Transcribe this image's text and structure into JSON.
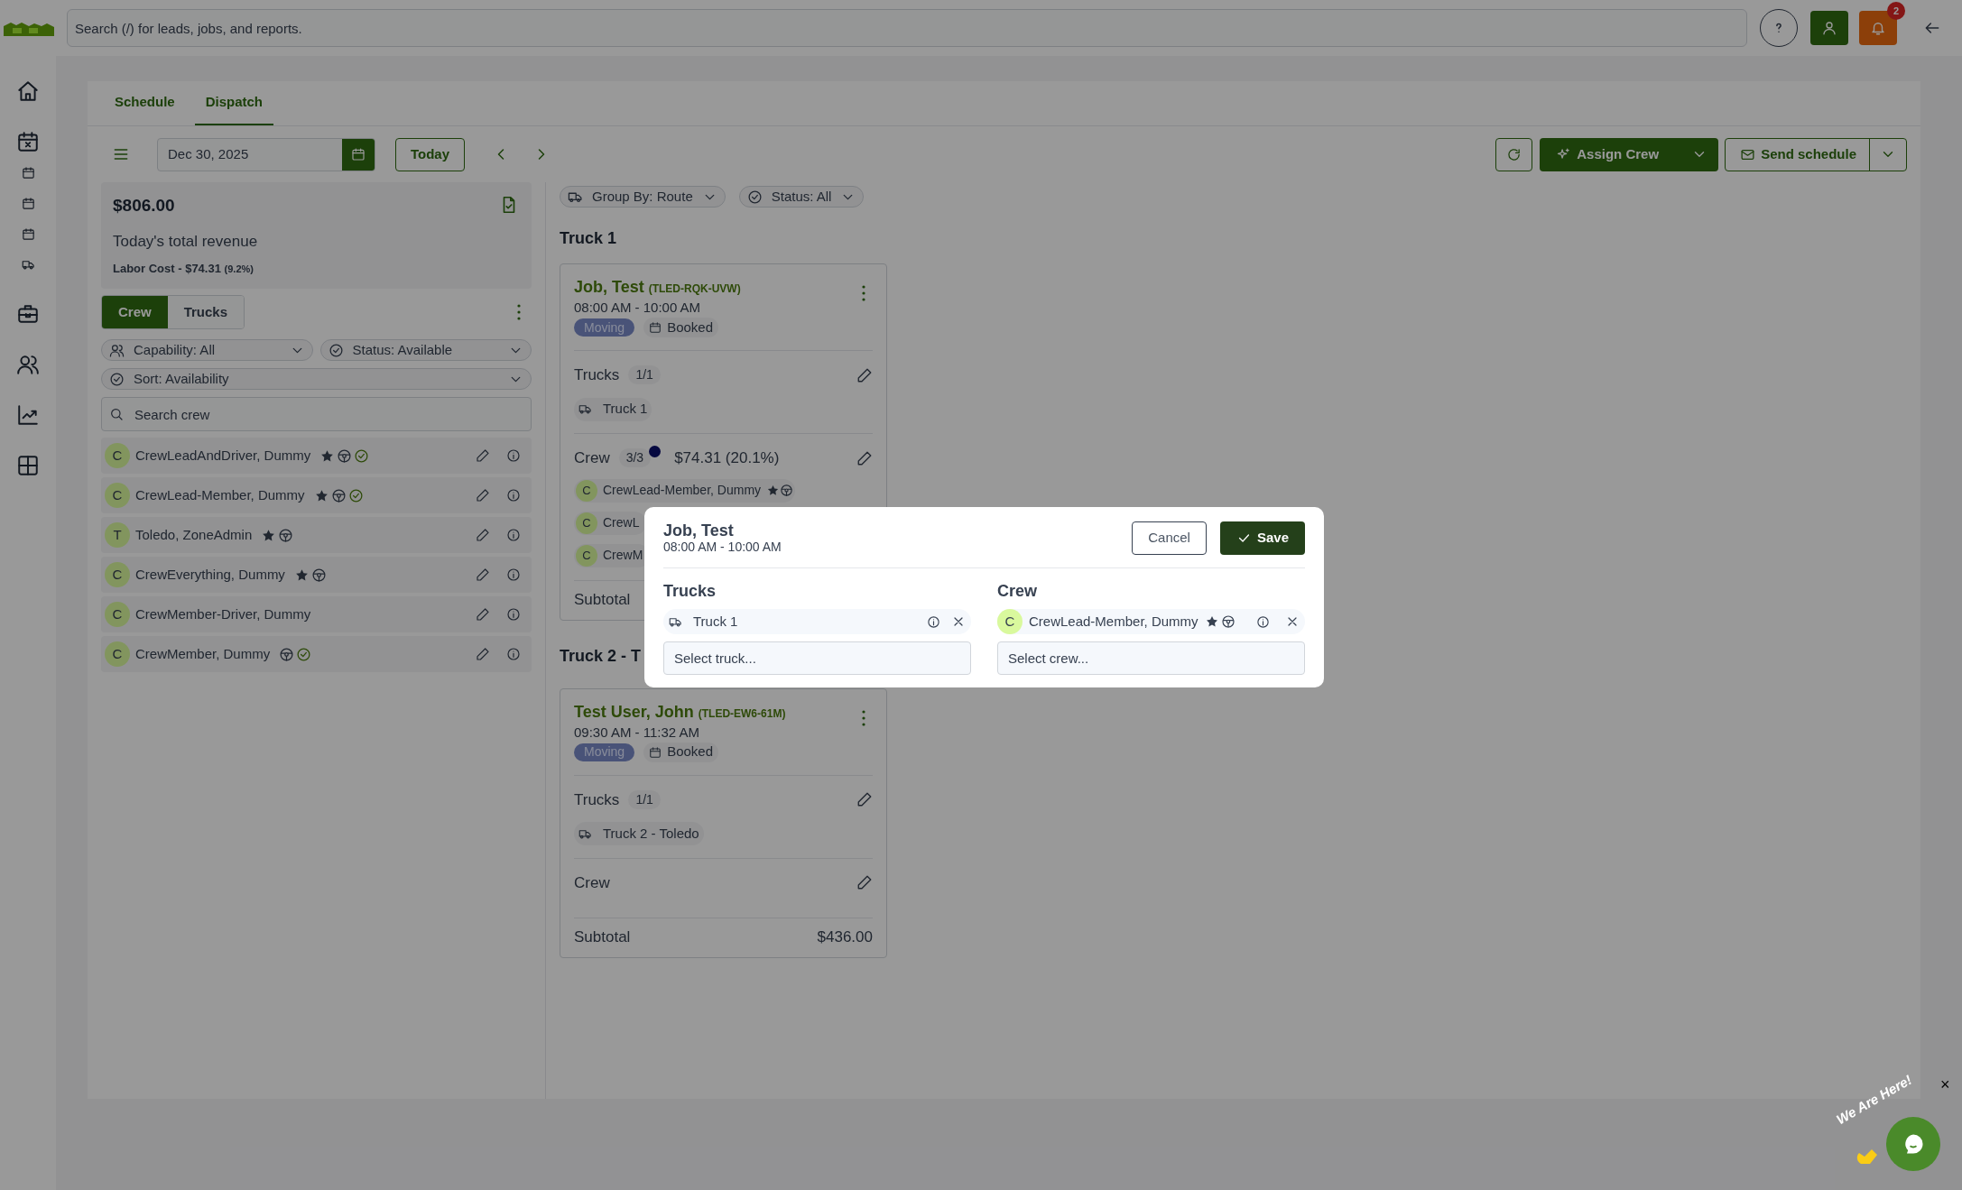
{
  "topbar": {
    "search_placeholder": "Search (/) for leads, jobs, and reports.",
    "notification_count": "2"
  },
  "tabs": [
    {
      "label": "Schedule",
      "selected": false
    },
    {
      "label": "Dispatch",
      "selected": true
    }
  ],
  "toolbar": {
    "date": "Dec 30, 2025",
    "today": "Today",
    "assign_crew": "Assign Crew",
    "send_schedule": "Send schedule"
  },
  "summary": {
    "revenue": "$806.00",
    "label": "Today's total revenue",
    "labor_cost": "Labor Cost - $74.31",
    "labor_share": "(9.2%)"
  },
  "panel_tabs": [
    {
      "label": "Crew",
      "selected": true
    },
    {
      "label": "Trucks",
      "selected": false
    }
  ],
  "filters": [
    {
      "kind": "people",
      "label": "Capability: All"
    },
    {
      "kind": "check",
      "label": "Status: Available"
    },
    {
      "kind": "check",
      "label": "Sort: Availability"
    }
  ],
  "crew_search": {
    "placeholder": "Search crew"
  },
  "crew": [
    {
      "initial": "C",
      "name": "CrewLeadAndDriver, Dummy",
      "lead": true,
      "driver": true,
      "verified": true
    },
    {
      "initial": "C",
      "name": "CrewLead-Member, Dummy",
      "lead": true,
      "driver": true,
      "verified": true
    },
    {
      "initial": "T",
      "name": "Toledo, ZoneAdmin",
      "lead": true,
      "driver": true,
      "verified": false
    },
    {
      "initial": "C",
      "name": "CrewEverything, Dummy",
      "lead": true,
      "driver": true,
      "verified": false
    },
    {
      "initial": "C",
      "name": "CrewMember-Driver, Dummy",
      "lead": false,
      "driver": false,
      "verified": false
    },
    {
      "initial": "C",
      "name": "CrewMember, Dummy",
      "lead": false,
      "driver": true,
      "verified": true
    }
  ],
  "board_filters": [
    {
      "kind": "truck",
      "label": "Group By: Route"
    },
    {
      "kind": "check",
      "label": "Status: All"
    }
  ],
  "groups": [
    {
      "title": "Truck 1",
      "job": {
        "name": "Job, Test",
        "code": "(TLED-RQK-UVW)",
        "time": "08:00 AM - 10:00 AM",
        "type": "Moving",
        "status": "Booked",
        "trucks_label": "Trucks",
        "trucks_count": "1/1",
        "trucks": [
          "Truck 1"
        ],
        "crew_label": "Crew",
        "crew_count": "3/3",
        "crew_cost": "$74.31 (20.1%)",
        "crew": [
          {
            "initial": "C",
            "name": "CrewLead-Member, Dummy",
            "lead": true,
            "driver": true
          },
          {
            "initial": "C",
            "name": "CrewL",
            "lead": false,
            "driver": false
          },
          {
            "initial": "C",
            "name": "CrewM",
            "lead": false,
            "driver": false
          }
        ],
        "subtotal_label": "Subtotal"
      }
    },
    {
      "title": "Truck 2 - T",
      "job": {
        "name": "Test User, John",
        "code": "(TLED-EW6-61M)",
        "time": "09:30 AM - 11:32 AM",
        "type": "Moving",
        "status": "Booked",
        "trucks_label": "Trucks",
        "trucks_count": "1/1",
        "trucks": [
          "Truck 2 - Toledo"
        ],
        "crew_label": "Crew",
        "subtotal_label": "Subtotal",
        "subtotal": "$436.00"
      }
    }
  ],
  "modal": {
    "title": "Job, Test",
    "time": "08:00 AM - 10:00 AM",
    "cancel": "Cancel",
    "save": "Save",
    "trucks_title": "Trucks",
    "trucks": [
      "Truck 1"
    ],
    "truck_placeholder": "Select truck...",
    "crew_title": "Crew",
    "crew": [
      {
        "initial": "C",
        "name": "CrewLead-Member, Dummy",
        "lead": true,
        "driver": true
      }
    ],
    "crew_placeholder": "Select crew..."
  },
  "chat": {
    "label": "We Are Here!",
    "close": "×"
  }
}
